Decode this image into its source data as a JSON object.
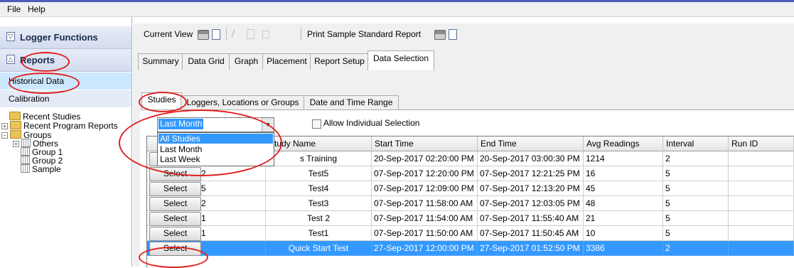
{
  "menu": {
    "file": "File",
    "help": "Help"
  },
  "sidebar": {
    "logger_functions": "Logger Functions",
    "reports": "Reports",
    "historical_data": "Historical Data",
    "calibration": "Calibration",
    "tree": {
      "recent_studies": "Recent Studies",
      "recent_program_reports": "Recent Program Reports",
      "groups": "Groups",
      "others": "Others",
      "group1": "Group 1",
      "group2": "Group 2",
      "sample": "Sample"
    }
  },
  "toolbar": {
    "current_view": "Current View",
    "print_sample": "Print Sample Standard Report"
  },
  "tabs": [
    "Summary",
    "Data Grid",
    "Graph",
    "Placement",
    "Report Setup",
    "Data Selection"
  ],
  "subtabs": [
    "Studies",
    "Loggers, Locations or Groups",
    "Date and Time Range"
  ],
  "filter": {
    "selected": "Last Month",
    "options": [
      "All Studies",
      "Last Month",
      "Last Week"
    ],
    "allow_individual": "Allow Individual Selection"
  },
  "grid": {
    "columns": [
      "Study Name",
      "Start Time",
      "End Time",
      "Avg Readings",
      "Interval",
      "Run ID"
    ],
    "rows": [
      {
        "btn": "",
        "num": "",
        "name": "s Training",
        "start": "20-Sep-2017 02:20:00 PM",
        "end": "20-Sep-2017 03:00:30 PM",
        "avg": "1214",
        "interval": "2",
        "run": ""
      },
      {
        "btn": "Select",
        "num": "2",
        "name": "Test5",
        "start": "07-Sep-2017 12:20:00 PM",
        "end": "07-Sep-2017 12:21:25 PM",
        "avg": "16",
        "interval": "5",
        "run": ""
      },
      {
        "btn": "Select",
        "num": "5",
        "name": "Test4",
        "start": "07-Sep-2017 12:09:00 PM",
        "end": "07-Sep-2017 12:13:20 PM",
        "avg": "45",
        "interval": "5",
        "run": ""
      },
      {
        "btn": "Select",
        "num": "2",
        "name": "Test3",
        "start": "07-Sep-2017 11:58:00 AM",
        "end": "07-Sep-2017 12:03:05 PM",
        "avg": "48",
        "interval": "5",
        "run": ""
      },
      {
        "btn": "Select",
        "num": "1",
        "name": "Test 2",
        "start": "07-Sep-2017 11:54:00 AM",
        "end": "07-Sep-2017 11:55:40 AM",
        "avg": "21",
        "interval": "5",
        "run": ""
      },
      {
        "btn": "Select",
        "num": "1",
        "name": "Test1",
        "start": "07-Sep-2017 11:50:00 AM",
        "end": "07-Sep-2017 11:50:45 AM",
        "avg": "10",
        "interval": "5",
        "run": ""
      },
      {
        "btn": "Select",
        "num": "",
        "name": "Quick Start Test",
        "start": "27-Sep-2017 12:00:00 PM",
        "end": "27-Sep-2017 01:52:50 PM",
        "avg": "3386",
        "interval": "2",
        "run": ""
      }
    ]
  },
  "colors": {
    "selection": "#3399ff",
    "annotation": "#e02020",
    "sidebar_highlight": "#cce8ff"
  }
}
